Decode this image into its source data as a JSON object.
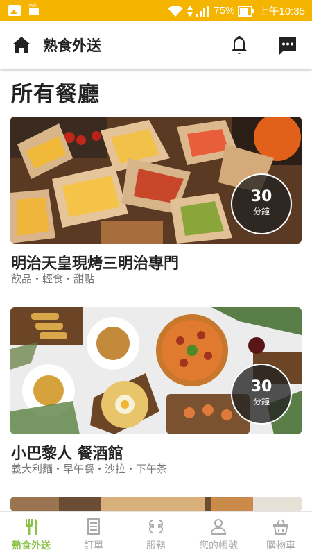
{
  "status_bar": {
    "battery": "75%",
    "time": "上午10:35",
    "data_label": "DATA"
  },
  "app_bar": {
    "title": "熟食外送",
    "icons": [
      "home-icon",
      "bell-icon",
      "message-icon"
    ]
  },
  "section_title": "所有餐廳",
  "restaurants": [
    {
      "name": "明治天皇現烤三明治專門",
      "tags": "飲品・輕食・甜點",
      "time_value": "30",
      "time_unit": "分鐘"
    },
    {
      "name": "小巴黎人 餐酒館",
      "tags": "義大利麵・早午餐・沙拉・下午茶",
      "time_value": "30",
      "time_unit": "分鐘"
    }
  ],
  "bottom_nav": [
    {
      "label": "熟食外送",
      "icon": "fork-knife-icon",
      "active": true
    },
    {
      "label": "訂單",
      "icon": "receipt-icon",
      "active": false
    },
    {
      "label": "服務",
      "icon": "services-icon",
      "active": false
    },
    {
      "label": "您的帳號",
      "icon": "person-icon",
      "active": false
    },
    {
      "label": "購物車",
      "icon": "basket-icon",
      "active": false
    }
  ],
  "colors": {
    "status_bar": "#f5b400",
    "nav_active": "#8bc34a",
    "nav_inactive": "#aaaaaa"
  }
}
